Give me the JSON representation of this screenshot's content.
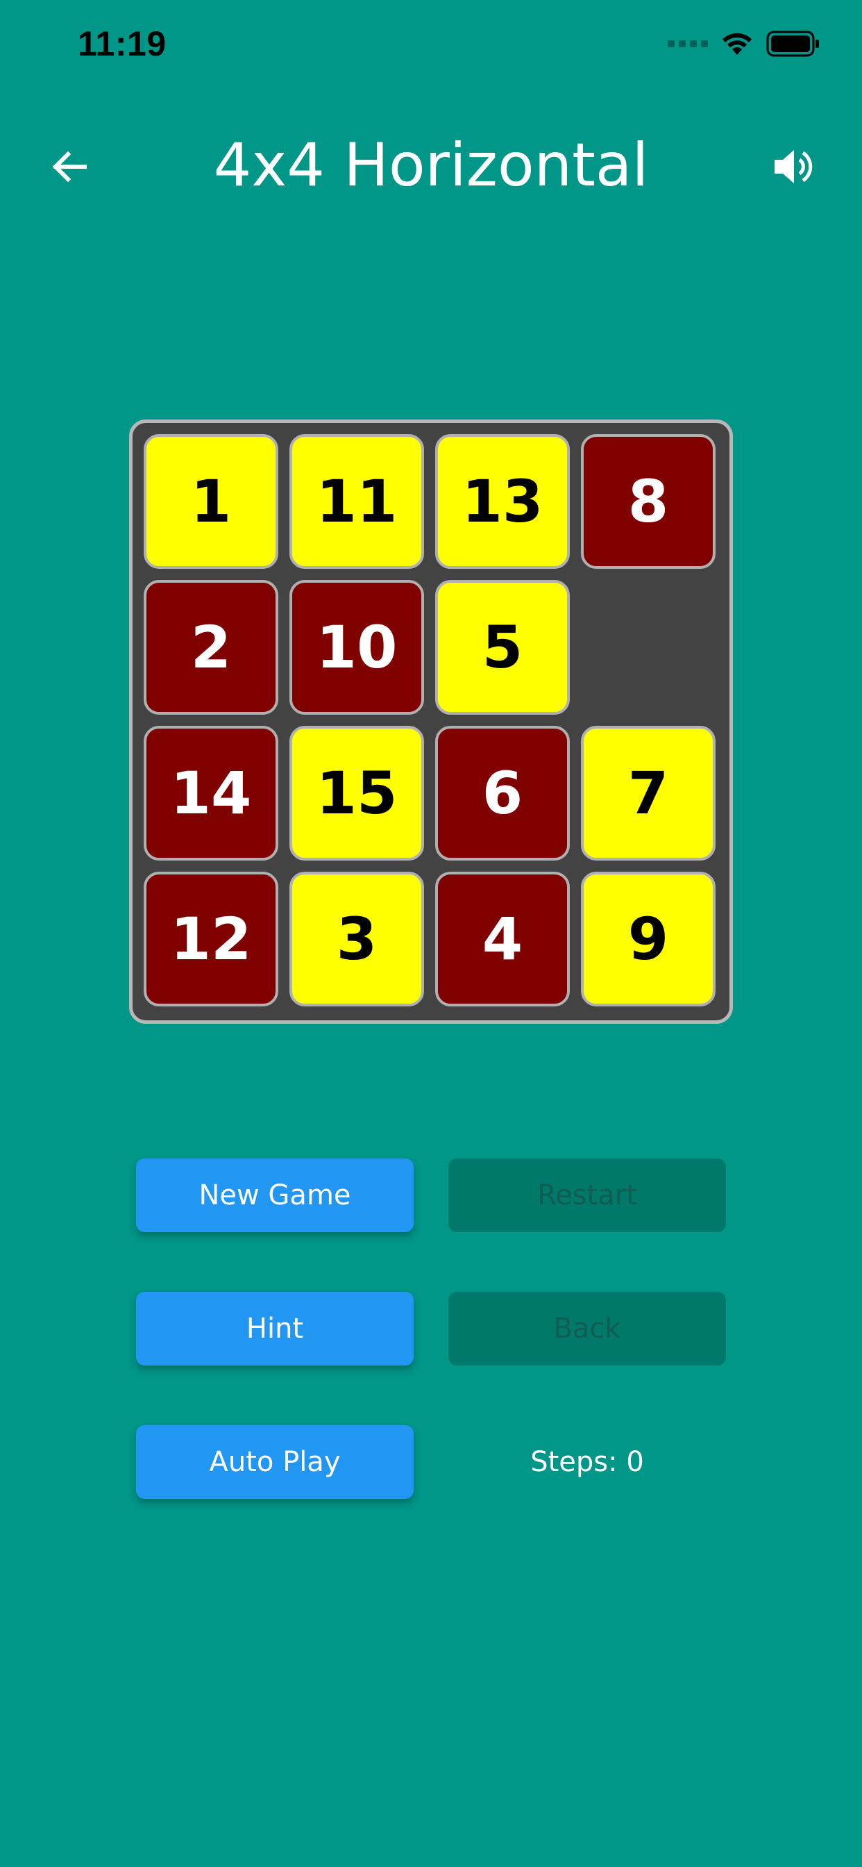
{
  "status_bar": {
    "time": "11:19"
  },
  "app_bar": {
    "title": "4x4 Horizontal",
    "back_icon": "arrow-left-icon",
    "sound_icon": "volume-up-icon"
  },
  "colors": {
    "background": "#009688",
    "tile_yellow": "#ffff00",
    "tile_red": "#800000",
    "button_primary": "#2196f3",
    "button_disabled": "#00796b",
    "board": "#434343"
  },
  "board": {
    "rows": [
      [
        {
          "value": "1",
          "color": "yellow"
        },
        {
          "value": "11",
          "color": "yellow"
        },
        {
          "value": "13",
          "color": "yellow"
        },
        {
          "value": "8",
          "color": "red"
        }
      ],
      [
        {
          "value": "2",
          "color": "red"
        },
        {
          "value": "10",
          "color": "red"
        },
        {
          "value": "5",
          "color": "yellow"
        },
        null
      ],
      [
        {
          "value": "14",
          "color": "red"
        },
        {
          "value": "15",
          "color": "yellow"
        },
        {
          "value": "6",
          "color": "red"
        },
        {
          "value": "7",
          "color": "yellow"
        }
      ],
      [
        {
          "value": "12",
          "color": "red"
        },
        {
          "value": "3",
          "color": "yellow"
        },
        {
          "value": "4",
          "color": "red"
        },
        {
          "value": "9",
          "color": "yellow"
        }
      ]
    ]
  },
  "buttons": {
    "new_game": "New Game",
    "restart": "Restart",
    "hint": "Hint",
    "back": "Back",
    "auto_play": "Auto Play"
  },
  "steps_text": "Steps: 0"
}
